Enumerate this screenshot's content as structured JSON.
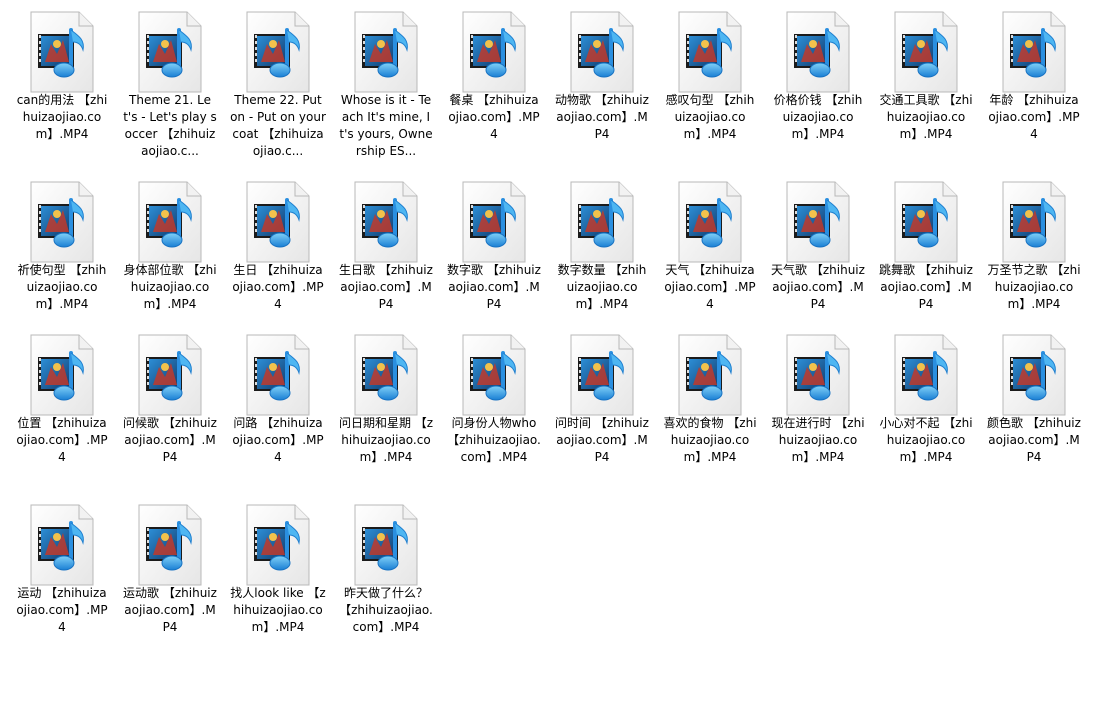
{
  "window": {
    "title": "",
    "view": "Large icons"
  },
  "file_type_icon": "video-audio-file-icon",
  "files": [
    {
      "name": "can的用法 【zhihuizaojiao.com】.MP4"
    },
    {
      "name": "Theme 21. Let's - Let's play soccer 【zhihuizaojiao.c..."
    },
    {
      "name": "Theme 22. Put on - Put on your coat 【zhihuizaojiao.c..."
    },
    {
      "name": "Whose is it - Teach It's mine, It's yours, Ownership ES..."
    },
    {
      "name": "餐桌 【zhihuizaojiao.com】.MP4"
    },
    {
      "name": "动物歌 【zhihuizaojiao.com】.MP4"
    },
    {
      "name": "感叹句型 【zhihuizaojiao.com】.MP4"
    },
    {
      "name": "价格价钱 【zhihuizaojiao.com】.MP4"
    },
    {
      "name": "交通工具歌 【zhihuizaojiao.com】.MP4"
    },
    {
      "name": "年龄 【zhihuizaojiao.com】.MP4"
    },
    {
      "name": "祈使句型 【zhihuizaojiao.com】.MP4"
    },
    {
      "name": "身体部位歌 【zhihuizaojiao.com】.MP4"
    },
    {
      "name": "生日 【zhihuizaojiao.com】.MP4"
    },
    {
      "name": "生日歌 【zhihuizaojiao.com】.MP4"
    },
    {
      "name": "数字歌 【zhihuizaojiao.com】.MP4"
    },
    {
      "name": "数字数量 【zhihuizaojiao.com】.MP4"
    },
    {
      "name": "天气 【zhihuizaojiao.com】.MP4"
    },
    {
      "name": "天气歌 【zhihuizaojiao.com】.MP4"
    },
    {
      "name": "跳舞歌 【zhihuizaojiao.com】.MP4"
    },
    {
      "name": "万圣节之歌 【zhihuizaojiao.com】.MP4"
    },
    {
      "name": "位置 【zhihuizaojiao.com】.MP4"
    },
    {
      "name": "问候歌 【zhihuizaojiao.com】.MP4"
    },
    {
      "name": "问路 【zhihuizaojiao.com】.MP4"
    },
    {
      "name": "问日期和星期 【zhihuizaojiao.com】.MP4"
    },
    {
      "name": "问身份人物who 【zhihuizaojiao.com】.MP4"
    },
    {
      "name": "问时间 【zhihuizaojiao.com】.MP4"
    },
    {
      "name": "喜欢的食物 【zhihuizaojiao.com】.MP4"
    },
    {
      "name": "现在进行时 【zhihuizaojiao.com】.MP4"
    },
    {
      "name": "小心对不起 【zhihuizaojiao.com】.MP4"
    },
    {
      "name": "颜色歌 【zhihuizaojiao.com】.MP4"
    },
    {
      "name": "运动 【zhihuizaojiao.com】.MP4"
    },
    {
      "name": "运动歌 【zhihuizaojiao.com】.MP4"
    },
    {
      "name": "找人look like 【zhihuizaojiao.com】.MP4"
    },
    {
      "name": "昨天做了什么？【zhihuizaojiao.com】.MP4"
    }
  ]
}
